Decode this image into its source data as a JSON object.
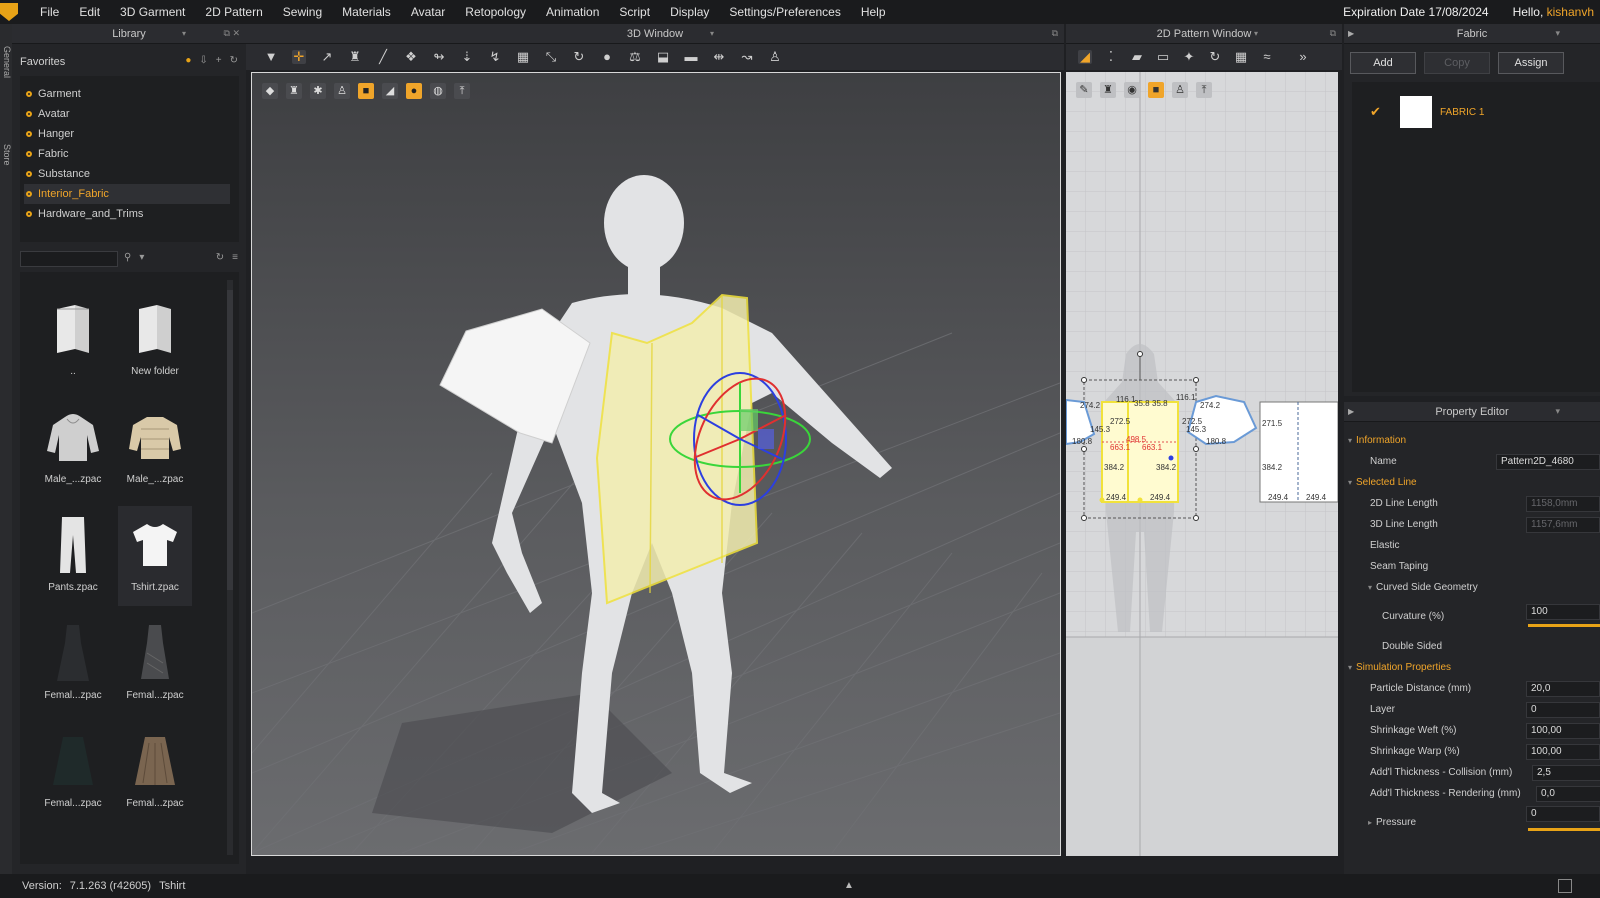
{
  "menu": {
    "items": [
      "File",
      "Edit",
      "3D Garment",
      "2D Pattern",
      "Sewing",
      "Materials",
      "Avatar",
      "Retopology",
      "Animation",
      "Script",
      "Display",
      "Settings/Preferences",
      "Help"
    ],
    "expiration": "Expiration Date 17/08/2024",
    "hello": "Hello,",
    "user": "kishanvh"
  },
  "left_strip": {
    "tabs": [
      "General",
      "Store"
    ]
  },
  "library": {
    "title": "Library",
    "favorites_title": "Favorites",
    "favorites": [
      "Garment",
      "Avatar",
      "Hanger",
      "Fabric",
      "Substance",
      "Interior_Fabric",
      "Hardware_and_Trims"
    ],
    "active_index": 5,
    "items": [
      {
        "label": "..",
        "icon": "folder-icon"
      },
      {
        "label": "New folder",
        "icon": "folder-icon"
      },
      {
        "label": "Male_...zpac",
        "icon": "hoodie-icon"
      },
      {
        "label": "Male_...zpac",
        "icon": "puffer-jacket-icon"
      },
      {
        "label": "Pants.zpac",
        "icon": "pants-icon"
      },
      {
        "label": "Tshirt.zpac",
        "icon": "tshirt-icon"
      },
      {
        "label": "Femal...zpac",
        "icon": "dress-icon"
      },
      {
        "label": "Femal...zpac",
        "icon": "dress-icon"
      },
      {
        "label": "Femal...zpac",
        "icon": "skirt-icon"
      },
      {
        "label": "Femal...zpac",
        "icon": "skirt-icon"
      }
    ]
  },
  "window3d": {
    "title": "3D Window"
  },
  "window2d": {
    "title": "2D Pattern Window",
    "measurements": [
      "274.2",
      "272.5",
      "116.1",
      "35.8",
      "35.8",
      "116.1",
      "272.5",
      "274.2",
      "145.3",
      "145.3",
      "180.8",
      "180.8",
      "384.2",
      "384.2",
      "249.4",
      "249.4",
      "498.5",
      "663.1",
      "663.1",
      "271.5",
      "384.2",
      "249.4",
      "249.4"
    ]
  },
  "fabric": {
    "title": "Fabric",
    "buttons": {
      "add": "Add",
      "copy": "Copy",
      "assign": "Assign"
    },
    "item_name": "FABRIC 1"
  },
  "property_editor": {
    "title": "Property Editor",
    "information": "Information",
    "name_label": "Name",
    "name_value": "Pattern2D_4680",
    "selected_line": "Selected Line",
    "line2d_label": "2D Line Length",
    "line2d_value": "1158,0mm",
    "line3d_label": "3D Line Length",
    "line3d_value": "1157,6mm",
    "elastic_label": "Elastic",
    "seam_taping_label": "Seam Taping",
    "curved_side_label": "Curved Side Geometry",
    "curvature_label": "Curvature (%)",
    "curvature_value": "100",
    "double_sided_label": "Double Sided",
    "simulation": "Simulation Properties",
    "particle_label": "Particle Distance (mm)",
    "particle_value": "20,0",
    "layer_label": "Layer",
    "layer_value": "0",
    "weft_label": "Shrinkage Weft (%)",
    "weft_value": "100,00",
    "warp_label": "Shrinkage Warp (%)",
    "warp_value": "100,00",
    "collision_label": "Add'l Thickness - Collision (mm)",
    "collision_value": "2,5",
    "rendering_label": "Add'l Thickness - Rendering (mm)",
    "rendering_value": "0,0",
    "pressure_label": "Pressure",
    "pressure_value": "0"
  },
  "status": {
    "version_label": "Version:",
    "version": "7.1.263 (r42605)",
    "file": "Tshirt"
  }
}
